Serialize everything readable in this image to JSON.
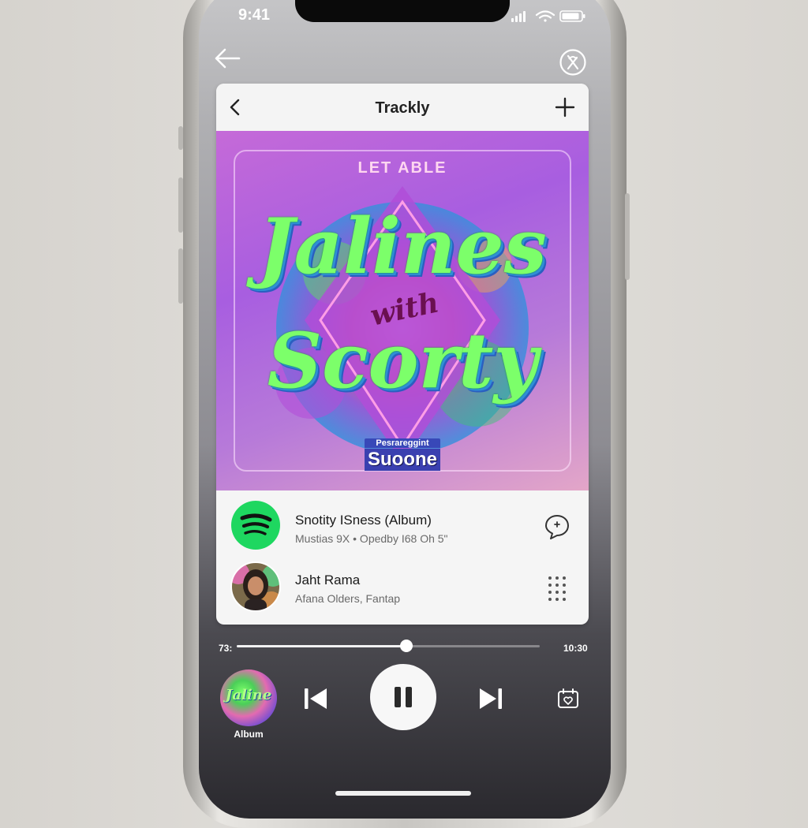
{
  "status": {
    "time": "9:41"
  },
  "top_bar": {
    "back_icon": "arrow-left-icon",
    "close_icon": "circle-close-icon"
  },
  "card": {
    "title": "Trackly",
    "back_icon": "chevron-left-icon",
    "add_icon": "plus-icon"
  },
  "cover": {
    "heading": "LET ABLE",
    "title_line_1": "Jalines",
    "title_sub": "with",
    "title_line_2": "Scorty",
    "badge_top": "Pesrareggint",
    "badge": "Suoone"
  },
  "tracks": [
    {
      "title": "Snotity ISness (Album)",
      "subtitle": "Mustias 9X • Opedby I68 Oh 5\"",
      "icon": "spotify-logo-icon",
      "action_icon": "chat-bubble-icon"
    },
    {
      "title": "Jaht Rama",
      "subtitle": "Afana Olders, Fantap",
      "icon": "avatar",
      "action_icon": "grid-dots-icon"
    }
  ],
  "player": {
    "elapsed": "73:",
    "duration": "10:30",
    "progress": 0.56,
    "prev_icon": "skip-back-icon",
    "play_icon": "pause-icon",
    "next_icon": "skip-forward-icon",
    "extra_icon": "calendar-heart-icon",
    "mini_album_text": "Jaline",
    "mini_label": "Album"
  },
  "colors": {
    "spotify_green": "#1ed760",
    "cover_purple": "#b36be0",
    "title_green": "#7cff6a"
  }
}
